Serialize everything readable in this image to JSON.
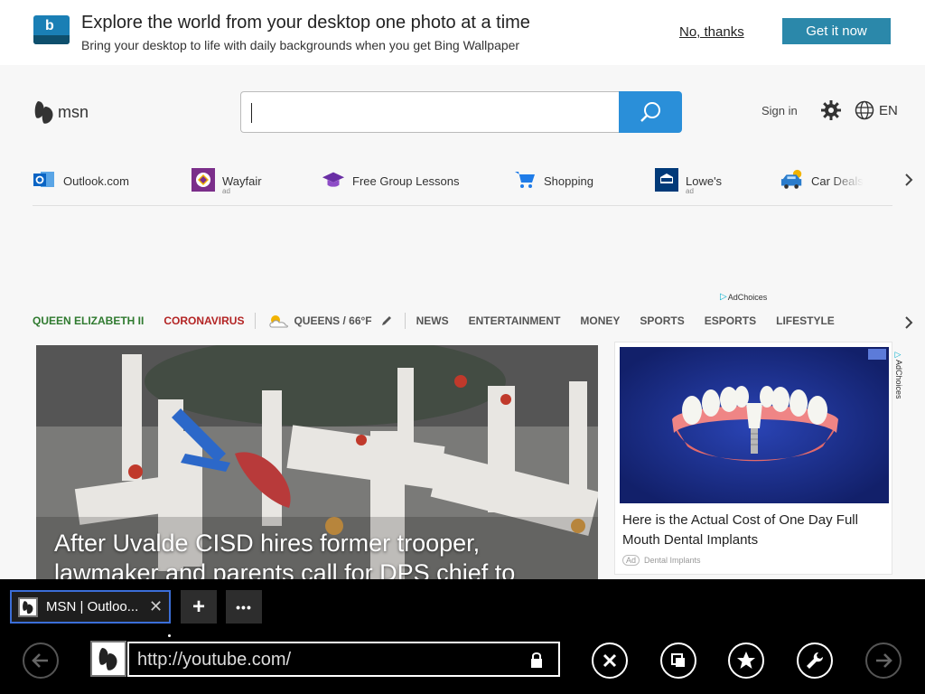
{
  "promo": {
    "logo_letter": "b",
    "title": "Explore the world from your desktop one photo at a time",
    "subtitle": "Bring your desktop to life with daily backgrounds when you get Bing Wallpaper",
    "dismiss": "No, thanks",
    "cta": "Get it now"
  },
  "header": {
    "logo_text": "msn",
    "search_value": "",
    "sign_in": "Sign in",
    "language": "EN"
  },
  "quick_links": [
    {
      "label": "Outlook.com",
      "ad": "",
      "icon": "outlook-icon"
    },
    {
      "label": "Wayfair",
      "ad": "ad",
      "icon": "wayfair-icon"
    },
    {
      "label": "Free Group Lessons",
      "ad": "",
      "icon": "graduation-cap-icon"
    },
    {
      "label": "Shopping",
      "ad": "",
      "icon": "shopping-cart-icon"
    },
    {
      "label": "Lowe's",
      "ad": "ad",
      "icon": "lowes-icon"
    },
    {
      "label": "Car Deals",
      "ad": "",
      "icon": "car-icon"
    }
  ],
  "adchoices": "AdChoices",
  "categories": {
    "highlight1": "QUEEN ELIZABETH II",
    "highlight2": "CORONAVIRUS",
    "weather": "QUEENS / 66°F",
    "items": [
      "NEWS",
      "ENTERTAINMENT",
      "MONEY",
      "SPORTS",
      "ESPORTS",
      "LIFESTYLE"
    ]
  },
  "hero": {
    "title": "After Uvalde CISD hires former trooper, lawmaker and parents call for DPS chief to"
  },
  "ad": {
    "title": "Here is the Actual Cost of One Day Full Mouth Dental Implants",
    "badge": "Ad",
    "source": "Dental Implants",
    "side_label": "AdChoices"
  },
  "browser": {
    "tab_title": "MSN | Outloo...",
    "url": "http://youtube.com/"
  },
  "colors": {
    "accent": "#2a8fd9",
    "promo_cta": "#2b88aa",
    "queen": "#2f7a2f",
    "corona": "#b32424",
    "tab_border": "#3b6ed8"
  }
}
